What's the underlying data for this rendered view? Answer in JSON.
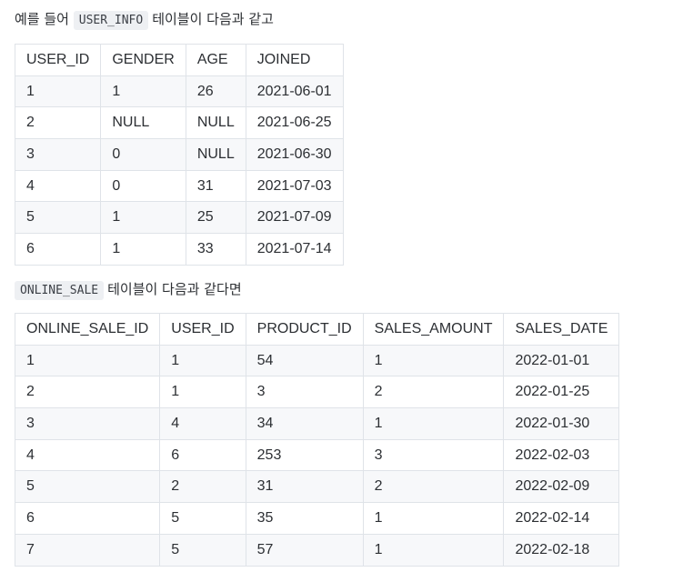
{
  "intro": {
    "prefix": "예를 들어",
    "table_name": "USER_INFO",
    "suffix": "테이블이 다음과 같고"
  },
  "user_info": {
    "columns": [
      "USER_ID",
      "GENDER",
      "AGE",
      "JOINED"
    ],
    "rows": [
      [
        "1",
        "1",
        "26",
        "2021-06-01"
      ],
      [
        "2",
        "NULL",
        "NULL",
        "2021-06-25"
      ],
      [
        "3",
        "0",
        "NULL",
        "2021-06-30"
      ],
      [
        "4",
        "0",
        "31",
        "2021-07-03"
      ],
      [
        "5",
        "1",
        "25",
        "2021-07-09"
      ],
      [
        "6",
        "1",
        "33",
        "2021-07-14"
      ]
    ]
  },
  "second": {
    "table_name": "ONLINE_SALE",
    "suffix": "테이블이 다음과 같다면"
  },
  "online_sale": {
    "columns": [
      "ONLINE_SALE_ID",
      "USER_ID",
      "PRODUCT_ID",
      "SALES_AMOUNT",
      "SALES_DATE"
    ],
    "rows": [
      [
        "1",
        "1",
        "54",
        "1",
        "2022-01-01"
      ],
      [
        "2",
        "1",
        "3",
        "2",
        "2022-01-25"
      ],
      [
        "3",
        "4",
        "34",
        "1",
        "2022-01-30"
      ],
      [
        "4",
        "6",
        "253",
        "3",
        "2022-02-03"
      ],
      [
        "5",
        "2",
        "31",
        "2",
        "2022-02-09"
      ],
      [
        "6",
        "5",
        "35",
        "1",
        "2022-02-14"
      ],
      [
        "7",
        "5",
        "57",
        "1",
        "2022-02-18"
      ]
    ]
  }
}
